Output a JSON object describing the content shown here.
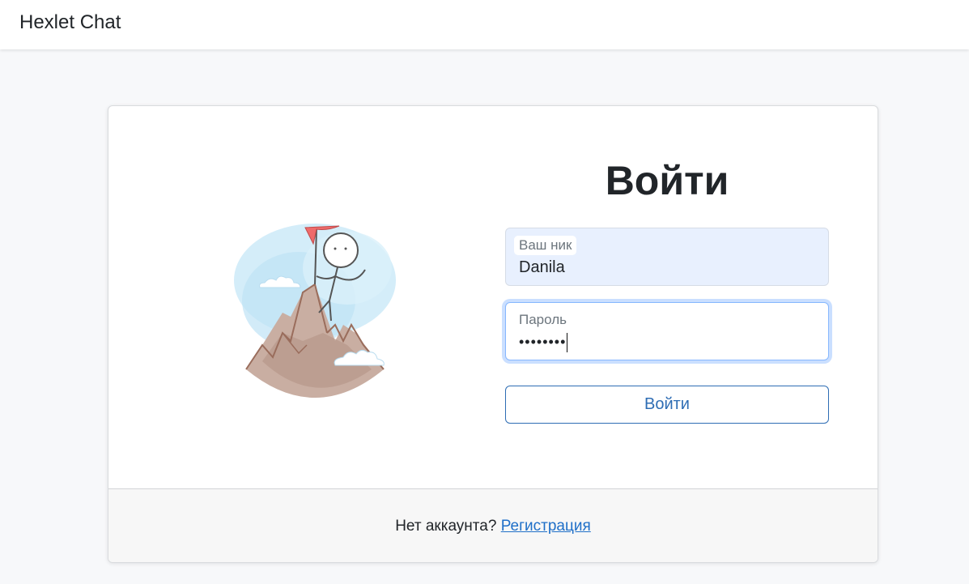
{
  "navbar": {
    "brand": "Hexlet Chat"
  },
  "login": {
    "title": "Войти",
    "username": {
      "label": "Ваш ник",
      "value": "Danila"
    },
    "password": {
      "label": "Пароль",
      "masked_value": "••••••••"
    },
    "submit_label": "Войти"
  },
  "footer": {
    "text": "Нет аккаунта?",
    "link": "Регистрация"
  },
  "colors": {
    "accent": "#2e6db4",
    "input_autofill_bg": "#e8f0fe",
    "focus_border": "#86b7fe",
    "flag": "#ef6b6b"
  },
  "icons": {
    "illustration": "stick-figure-on-mountain-with-flag"
  }
}
